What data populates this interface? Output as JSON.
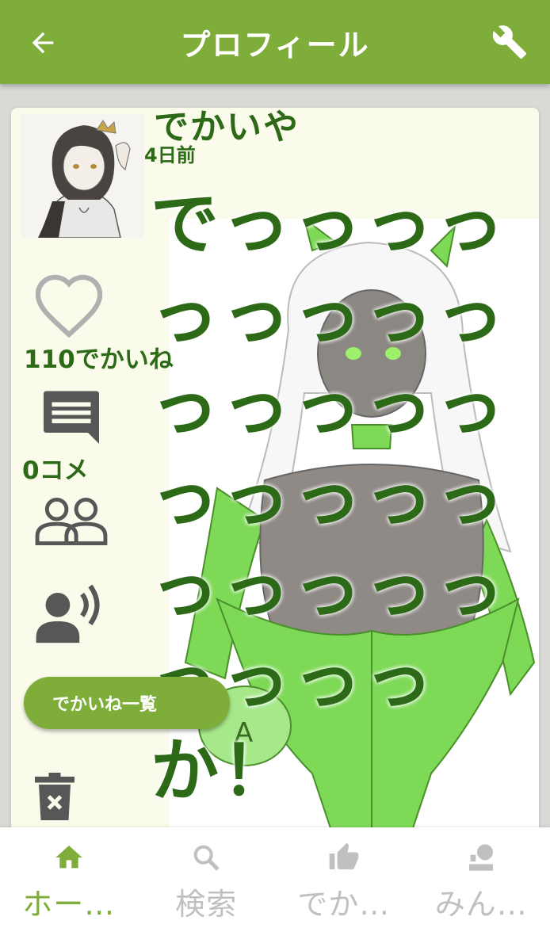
{
  "app": {
    "title": "プロフィール"
  },
  "colors": {
    "accent": "#7ead3a",
    "text_green": "#2d6a18",
    "card_bg": "#fbfbec",
    "inactive": "#c0c0c0"
  },
  "post": {
    "username": "でかいや",
    "time_ago": "4日前",
    "text": "でっっっっっっっっっっっっっっっっっっっっっっっっっっっっか！",
    "like_count": "110でかいね",
    "comment_count": "0コメ",
    "likes_list_button": "でかいね一覧"
  },
  "icons": {
    "back": "back-arrow-icon",
    "settings": "wrench-icon",
    "like": "heart-icon",
    "comment": "comment-icon",
    "people": "people-icon",
    "speak": "speaker-person-icon",
    "delete": "trash-icon"
  },
  "nav": {
    "items": [
      {
        "label": "ホー…",
        "icon": "home-icon",
        "active": true
      },
      {
        "label": "検索",
        "icon": "search-icon",
        "active": false
      },
      {
        "label": "でか…",
        "icon": "thumbs-up-icon",
        "active": false
      },
      {
        "label": "みん…",
        "icon": "people-board-icon",
        "active": false
      }
    ]
  }
}
